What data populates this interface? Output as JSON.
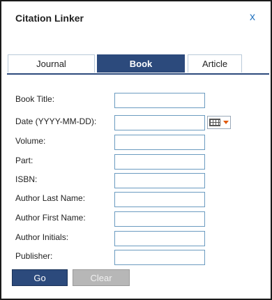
{
  "dialog": {
    "title": "Citation Linker",
    "close_label": "x"
  },
  "tabs": [
    {
      "label": "Journal",
      "active": false
    },
    {
      "label": "Book",
      "active": true
    },
    {
      "label": "Article",
      "active": false
    }
  ],
  "form": {
    "fields": [
      {
        "label": "Book Title:",
        "value": ""
      },
      {
        "label": "Date (YYYY-MM-DD):",
        "value": ""
      },
      {
        "label": "Volume:",
        "value": ""
      },
      {
        "label": "Part:",
        "value": ""
      },
      {
        "label": "ISBN:",
        "value": ""
      },
      {
        "label": "Author Last Name:",
        "value": ""
      },
      {
        "label": "Author First Name:",
        "value": ""
      },
      {
        "label": "Author Initials:",
        "value": ""
      },
      {
        "label": "Publisher:",
        "value": ""
      }
    ],
    "calendar_icon": "calendar-icon"
  },
  "buttons": {
    "go": "Go",
    "clear": "Clear"
  },
  "colors": {
    "accent": "#2c4a7c",
    "close": "#2b78c2",
    "disabled": "#b7b7b7"
  }
}
